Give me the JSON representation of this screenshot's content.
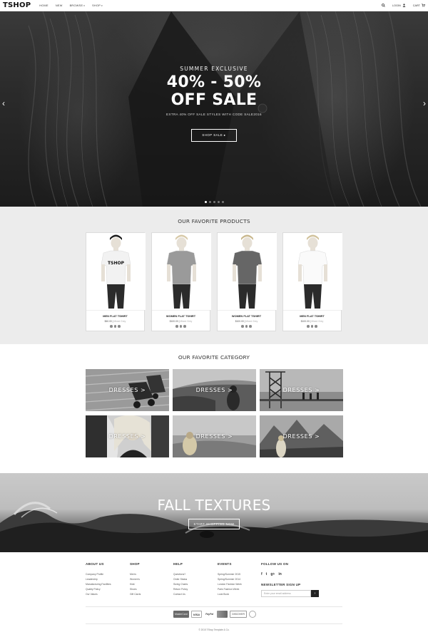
{
  "nav": {
    "logo": "TSHOP",
    "links": [
      "HOME",
      "NEW",
      "BROWSE",
      "SHOP"
    ],
    "login": "LOGIN",
    "cart": "CART"
  },
  "hero": {
    "kicker": "SUMMER EXCLUSIVE",
    "title_line1": "40% - 50%",
    "title_line2": "OFF SALE",
    "subtitle": "EXTRA 40% OFF SALE STYLES WITH CODE SALE2016",
    "button": "SHOP SALE ▸",
    "slides": 5,
    "active_slide": 1
  },
  "products": {
    "title": "OUR FAVORITE PRODUCTS",
    "items": [
      {
        "name": "MEN FLAT TSHIRT",
        "price": "$60.00",
        "was": "Mixed Grey",
        "shirt": "#f2f2f2",
        "hair": "#1a1a1a",
        "print": "TSHOP"
      },
      {
        "name": "WOMEN FLAT TSHIRT",
        "price": "$100.00",
        "was": "Mixed Grey",
        "shirt": "#9a9a9a",
        "hair": "#d7c9a8",
        "print": ""
      },
      {
        "name": "WOMEN FLAT TSHIRT",
        "price": "$100.00",
        "was": "Mixed Grey",
        "shirt": "#666666",
        "hair": "#c9b88e",
        "print": ""
      },
      {
        "name": "MEN FLAT TSHIRT",
        "price": "$100.00",
        "was": "Mixed Grey",
        "shirt": "#fafafa",
        "hair": "#d1c29c",
        "print": ""
      }
    ]
  },
  "categories": {
    "title": "OUR FAVORITE CATEGORY",
    "items": [
      {
        "label": "DRESSES >"
      },
      {
        "label": "DRESSES >"
      },
      {
        "label": "DRESSES >"
      },
      {
        "label": "DRESSES >"
      },
      {
        "label": "DRESSES >"
      },
      {
        "label": "DRESSES >"
      }
    ]
  },
  "banner": {
    "title": "FALL TEXTURES",
    "button": "START SHOPPING NOW"
  },
  "footer": {
    "about": {
      "title": "ABOUT US",
      "links": [
        "Company Profile",
        "Leadership",
        "Manufacturing Facilities",
        "Quality Policy",
        "Our Values"
      ]
    },
    "shop": {
      "title": "SHOP",
      "links": [
        "Men's",
        "Women's",
        "Kids'",
        "Shoes",
        "Gift Cards"
      ]
    },
    "help": {
      "title": "HELP",
      "links": [
        "Questions?",
        "Order Status",
        "Sizing Charts",
        "Return Policy",
        "Contact Us"
      ]
    },
    "events": {
      "title": "EVENTS",
      "links": [
        "Spring/Summer 2015",
        "Spring/Summer 2014",
        "London Fashion Week",
        "Paris Fashion Week",
        "Look Book"
      ]
    },
    "follow": {
      "title": "FOLLOW US ON",
      "icons": [
        "f",
        "t",
        "g+",
        "in"
      ]
    },
    "newsletter": {
      "title": "NEWSLETTER SIGN UP",
      "placeholder": "Enter your email address",
      "button": "›"
    },
    "payments": [
      "MasterCard",
      "VISA",
      "PayPal",
      "",
      "DISCOVER",
      ""
    ],
    "copyright": "© 2015 TShop Template & Co."
  }
}
